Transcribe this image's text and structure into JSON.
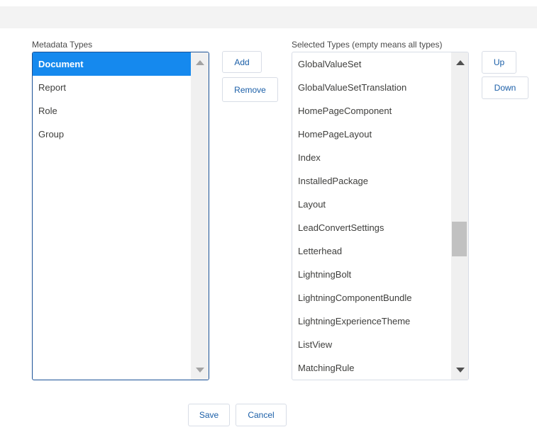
{
  "available": {
    "label": "Metadata Types",
    "items": [
      "Document",
      "Report",
      "Role",
      "Group"
    ],
    "selected_item": "Document"
  },
  "selected": {
    "label": "Selected Types (empty means all types)",
    "items": [
      "GlobalValueSet",
      "GlobalValueSetTranslation",
      "HomePageComponent",
      "HomePageLayout",
      "Index",
      "InstalledPackage",
      "Layout",
      "LeadConvertSettings",
      "Letterhead",
      "LightningBolt",
      "LightningComponentBundle",
      "LightningExperienceTheme",
      "ListView",
      "MatchingRule"
    ]
  },
  "buttons": {
    "add": "Add",
    "remove": "Remove",
    "up": "Up",
    "down": "Down",
    "save": "Save",
    "cancel": "Cancel"
  },
  "icons": {
    "scroll_up": "triangle-up-icon",
    "scroll_down": "triangle-down-icon"
  },
  "colors": {
    "selection": "#1589ee",
    "button_text": "#1b5fa8",
    "focus_border": "#1b5297"
  }
}
